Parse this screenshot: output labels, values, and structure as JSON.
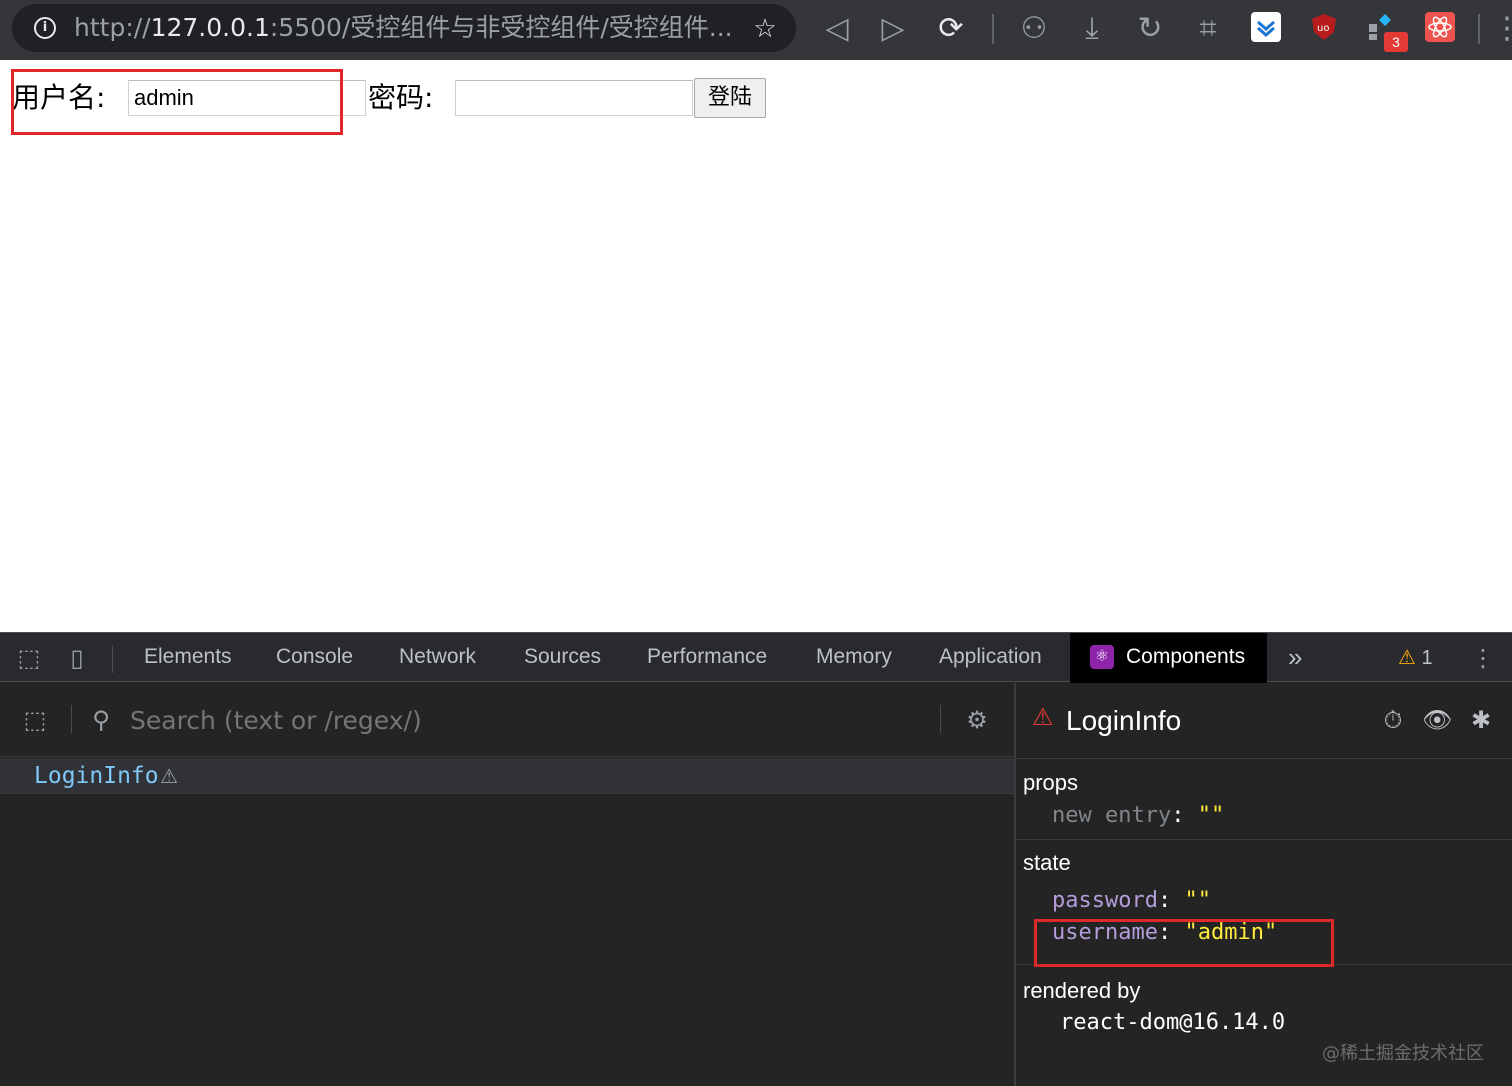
{
  "browser": {
    "url_scheme": "http://",
    "url_host": "127.0.0.1",
    "url_rest": ":5500/受控组件与非受控组件/受控组件....",
    "info_icon": "i",
    "extension_badge": "3"
  },
  "page": {
    "username_label": "用户名:",
    "username_value": "admin",
    "password_label": "密码:",
    "password_value": "",
    "login_button": "登陆"
  },
  "devtools": {
    "tabs": [
      "Elements",
      "Console",
      "Network",
      "Sources",
      "Performance",
      "Memory",
      "Application",
      "Components"
    ],
    "active_tab": "Components",
    "more_tabs": "»",
    "warning_count": "1",
    "search_placeholder": "Search (text or /regex/)",
    "tree_root": "LoginInfo",
    "inspector": {
      "component_name": "LoginInfo",
      "props_title": "props",
      "props": [
        {
          "key": "new entry",
          "value": "\"\""
        }
      ],
      "state_title": "state",
      "state": [
        {
          "key": "password",
          "value": "\"\""
        },
        {
          "key": "username",
          "value": "\"admin\""
        }
      ],
      "rendered_by_title": "rendered by",
      "rendered_by": "react-dom@16.14.0"
    },
    "watermark": "@稀土掘金技术社区"
  },
  "colors": {
    "highlight": "#e0272a",
    "react_purple": "#8e24aa",
    "state_key": "#b39ddb",
    "string_value": "#ffeb3b",
    "tree_name": "#7fc8f8"
  }
}
